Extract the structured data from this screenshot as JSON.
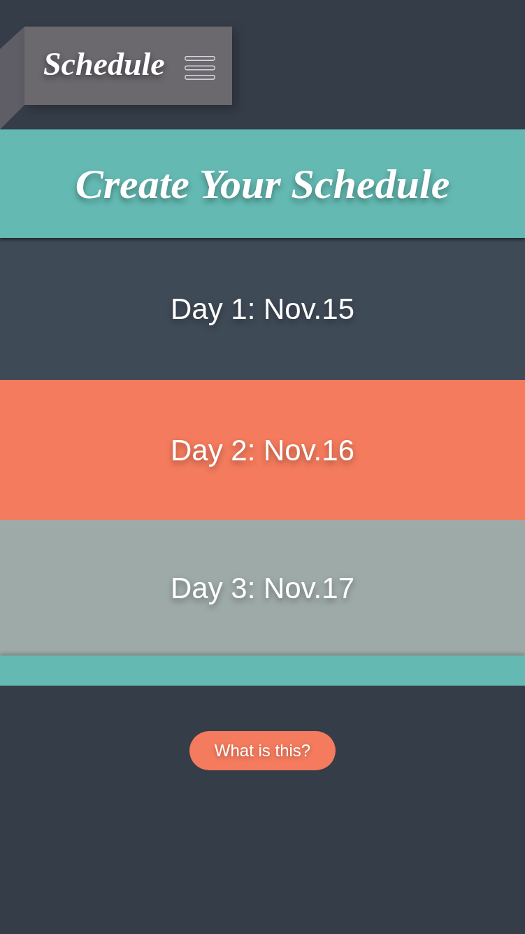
{
  "header": {
    "title": "Schedule"
  },
  "banner": {
    "title": "Create Your Schedule"
  },
  "days": [
    {
      "label": "Day 1: Nov.15",
      "color": "#3f4a57"
    },
    {
      "label": "Day 2: Nov.16",
      "color": "#f47b5d"
    },
    {
      "label": "Day 3: Nov.17",
      "color": "#9eaaa8"
    }
  ],
  "help_button": {
    "label": "What is this?"
  }
}
